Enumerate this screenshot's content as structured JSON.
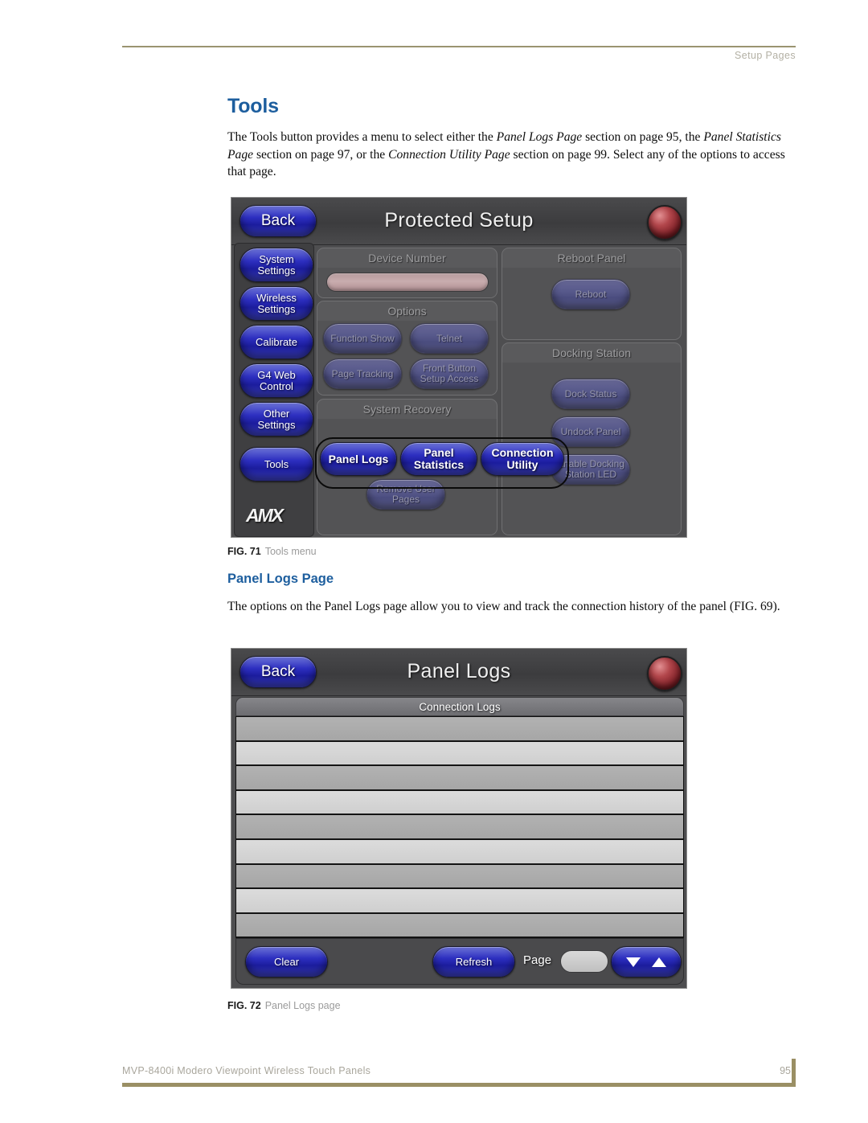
{
  "page": {
    "header_label": "Setup Pages",
    "footer_text": "MVP-8400i Modero Viewpoint Wireless Touch Panels",
    "page_number": "95",
    "accent_color": "#1d5e9e",
    "rule_color": "#9a8f64"
  },
  "sections": {
    "tools": {
      "heading": "Tools",
      "paragraph": "The Tools button provides a menu to select either the Panel Logs Page section on page 95, the Panel Statistics Page section on page 97, or the Connection Utility Page section on page 99. Select any of the options to access that page.",
      "paragraph_parts": [
        {
          "text": "The Tools button provides a menu to select either the ",
          "italic": false
        },
        {
          "text": "Panel Logs Page",
          "italic": true
        },
        {
          "text": " section on page 95, the ",
          "italic": false
        },
        {
          "text": "Panel Statistics Page",
          "italic": true
        },
        {
          "text": " section on page 97, or the ",
          "italic": false
        },
        {
          "text": "Connection Utility Page",
          "italic": true
        },
        {
          "text": " section on page 99. Select any of the options to access that page.",
          "italic": false
        }
      ]
    },
    "panel_logs": {
      "heading": "Panel Logs Page",
      "paragraph": "The options on the Panel Logs page allow you to view and track the connection history of the panel (FIG. 69)."
    }
  },
  "figures": {
    "fig71": {
      "number": "FIG. 71",
      "caption": "Tools menu"
    },
    "fig72": {
      "number": "FIG. 72",
      "caption": "Panel Logs page"
    }
  },
  "tools_screen": {
    "title": "Protected Setup",
    "back_button": "Back",
    "power_led": "power-led",
    "brand": "AMX",
    "sidebar": [
      {
        "label": "System Settings",
        "state": "active"
      },
      {
        "label": "Wireless Settings",
        "state": "active"
      },
      {
        "label": "Calibrate",
        "state": "active"
      },
      {
        "label": "G4 Web Control",
        "state": "active"
      },
      {
        "label": "Other Settings",
        "state": "active"
      },
      {
        "label": "Tools",
        "state": "active"
      }
    ],
    "groups": [
      {
        "title": "Device Number",
        "field_value": ""
      },
      {
        "title": "Options",
        "buttons": [
          {
            "label": "Function Show",
            "state": "dim"
          },
          {
            "label": "Telnet",
            "state": "dim"
          },
          {
            "label": "Page Tracking",
            "state": "dim"
          },
          {
            "label": "Front Button Setup Access",
            "state": "dim"
          }
        ]
      },
      {
        "title": "System Recovery",
        "buttons": [
          {
            "label": "Remove User Pages",
            "state": "dim"
          }
        ]
      },
      {
        "title": "Reboot Panel",
        "buttons": [
          {
            "label": "Reboot",
            "state": "dim"
          }
        ]
      },
      {
        "title": "Docking Station",
        "buttons": [
          {
            "label": "Dock Status",
            "state": "dim"
          },
          {
            "label": "Undock Panel",
            "state": "dim"
          },
          {
            "label": "Enable Docking Station LED",
            "state": "dim"
          }
        ]
      }
    ],
    "tools_submenu": [
      {
        "label": "Panel Logs",
        "state": "active"
      },
      {
        "label": "Panel Statistics",
        "state": "active"
      },
      {
        "label": "Connection Utility",
        "state": "active"
      }
    ]
  },
  "panel_logs_screen": {
    "title": "Panel Logs",
    "back_button": "Back",
    "power_led": "power-led",
    "list_header": "Connection Logs",
    "log_rows": [
      "",
      "",
      "",
      "",
      "",
      "",
      "",
      "",
      ""
    ],
    "footer": {
      "clear_button": "Clear",
      "refresh_button": "Refresh",
      "page_label": "Page",
      "page_value": "",
      "page_down_icon": "triangle-down-icon",
      "page_up_icon": "triangle-up-icon"
    }
  }
}
